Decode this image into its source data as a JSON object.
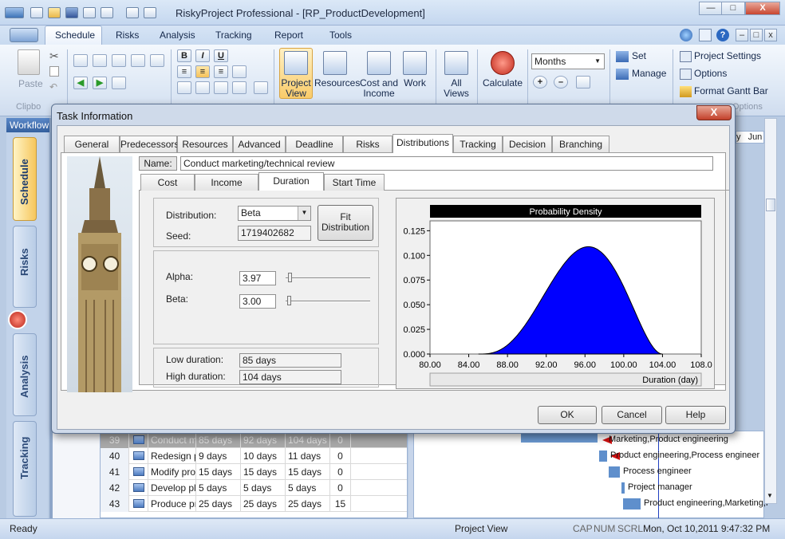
{
  "window": {
    "title": "RiskyProject Professional - [RP_ProductDevelopment]",
    "min": "—",
    "max": "□",
    "close": "X"
  },
  "ribbon_tabs": [
    "Schedule",
    "Risks",
    "Analysis",
    "Tracking",
    "Report",
    "Tools"
  ],
  "ribbon": {
    "paste": "Paste",
    "clipboard_group": "Clipbo",
    "project_view": "Project\nView",
    "resources": "Resources",
    "cost_income": "Cost and\nIncome",
    "work": "Work",
    "all_views": "All\nViews",
    "calculate": "Calculate",
    "timescale": "Months",
    "set": "Set",
    "manage": "Manage",
    "project_settings": "Project Settings",
    "options": "Options",
    "format_gantt": "Format Gantt Bar",
    "options_group": "Options",
    "bold": "B",
    "italic": "I",
    "underline": "U"
  },
  "left_panel": {
    "workflow": "Workflow",
    "tabs": [
      "Schedule",
      "Risks",
      "Analysis",
      "Tracking"
    ]
  },
  "grid_rows": [
    {
      "id": "39",
      "name": "Conduct ma",
      "dur": "85 days",
      "d2": "92 days",
      "d3": "104 days",
      "n": "0"
    },
    {
      "id": "40",
      "name": "Redesign p",
      "dur": "9 days",
      "d2": "10 days",
      "d3": "11 days",
      "n": "0"
    },
    {
      "id": "41",
      "name": "Modify prot",
      "dur": "15 days",
      "d2": "15 days",
      "d3": "15 days",
      "n": "0"
    },
    {
      "id": "42",
      "name": "Develop pla",
      "dur": "5 days",
      "d2": "5 days",
      "d3": "5 days",
      "n": "0"
    },
    {
      "id": "43",
      "name": "Produce pr",
      "dur": "25 days",
      "d2": "25 days",
      "d3": "25 days",
      "n": "15"
    }
  ],
  "gantt_labels": [
    "Marketing,Product engineering",
    "Product engineering,Process engineer",
    "Process engineer",
    "Project manager",
    "Product engineering,Marketing,P"
  ],
  "gantt_header_partial": [
    "y",
    "Jun"
  ],
  "status": {
    "ready": "Ready",
    "view": "Project View",
    "cap": "CAP",
    "num": "NUM",
    "scrl": "SCRL",
    "datetime": "Mon, Oct 10,2011   9:47:32 PM"
  },
  "dialog": {
    "title": "Task Information",
    "close": "X",
    "tabs": [
      "General",
      "Predecessors",
      "Resources",
      "Advanced",
      "Deadline",
      "Risks",
      "Distributions",
      "Tracking",
      "Decision",
      "Branching"
    ],
    "active_tab": "Distributions",
    "name_label": "Name:",
    "name_value": "Conduct marketing/technical review",
    "subtabs": [
      "Cost",
      "Income",
      "Duration",
      "Start Time"
    ],
    "active_subtab": "Duration",
    "distribution_label": "Distribution:",
    "distribution_value": "Beta",
    "fit_button": "Fit\nDistribution",
    "seed_label": "Seed:",
    "seed_value": "1719402682",
    "alpha_label": "Alpha:",
    "alpha_value": "3.97",
    "beta_label": "Beta:",
    "beta_value": "3.00",
    "alpha_level": 0.03,
    "beta_level": 0.02,
    "low_label": "Low duration:",
    "low_value": "85 days",
    "high_label": "High duration:",
    "high_value": "104 days",
    "ok": "OK",
    "cancel": "Cancel",
    "help": "Help"
  },
  "chart_data": {
    "type": "area",
    "title": "Probability Density",
    "xlabel": "Duration (day)",
    "xlim": [
      80,
      108
    ],
    "ylim": [
      0,
      0.135
    ],
    "x_ticks": [
      "80.00",
      "84.00",
      "88.00",
      "92.00",
      "96.00",
      "100.00",
      "104.00",
      "108.0"
    ],
    "y_ticks": [
      "0.000",
      "0.025",
      "0.050",
      "0.075",
      "0.100",
      "0.125"
    ],
    "distribution": {
      "name": "Beta",
      "alpha": 3.97,
      "beta": 3.0,
      "low": 85,
      "high": 104
    },
    "fill_color": "#0000ff"
  }
}
